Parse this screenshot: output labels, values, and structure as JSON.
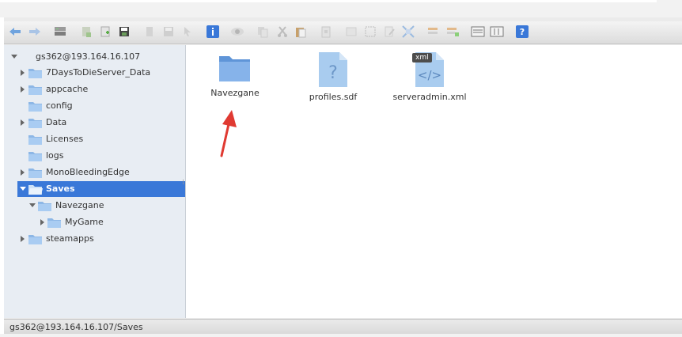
{
  "toolbar": {
    "buttons": [
      {
        "name": "back-icon"
      },
      {
        "name": "forward-icon"
      },
      {
        "name": "server-icon"
      },
      {
        "name": "new-folder-icon"
      },
      {
        "name": "new-file-icon"
      },
      {
        "name": "save-icon"
      },
      {
        "name": "open-icon"
      },
      {
        "name": "save-disabled-icon"
      },
      {
        "name": "select-icon"
      },
      {
        "name": "info-icon"
      },
      {
        "name": "preview-icon"
      },
      {
        "name": "copy-icon"
      },
      {
        "name": "cut-icon"
      },
      {
        "name": "paste-icon"
      },
      {
        "name": "duplicate-icon"
      },
      {
        "name": "rename-icon"
      },
      {
        "name": "select-all-icon"
      },
      {
        "name": "edit-icon"
      },
      {
        "name": "resize-icon"
      },
      {
        "name": "extract-icon"
      },
      {
        "name": "archive-icon"
      },
      {
        "name": "list-view-icon"
      },
      {
        "name": "sort-icon"
      },
      {
        "name": "help-icon"
      }
    ]
  },
  "tree": {
    "root": "gs362@193.164.16.107",
    "items": [
      {
        "label": "7DaysToDieServer_Data"
      },
      {
        "label": "appcache"
      },
      {
        "label": "config"
      },
      {
        "label": "Data"
      },
      {
        "label": "Licenses"
      },
      {
        "label": "logs"
      },
      {
        "label": "MonoBleedingEdge"
      },
      {
        "label": "Saves"
      },
      {
        "label": "Navezgane"
      },
      {
        "label": "MyGame"
      },
      {
        "label": "steamapps"
      }
    ]
  },
  "files": [
    {
      "name": "Navezgane",
      "type": "folder"
    },
    {
      "name": "profiles.sdf",
      "type": "unknown"
    },
    {
      "name": "serveradmin.xml",
      "type": "xml",
      "badge": "xml"
    }
  ],
  "status": {
    "path": "gs362@193.164.16.107/Saves"
  },
  "colors": {
    "selection": "#3a78d8",
    "folder": "#7fb1ea",
    "annotation_arrow": "#e03a32"
  }
}
